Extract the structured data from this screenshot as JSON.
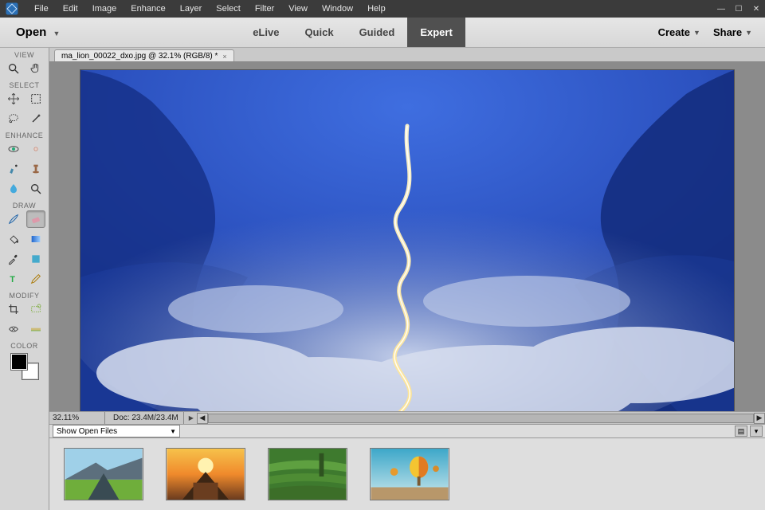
{
  "menubar": {
    "items": [
      "File",
      "Edit",
      "Image",
      "Enhance",
      "Layer",
      "Select",
      "Filter",
      "View",
      "Window",
      "Help"
    ]
  },
  "actionbar": {
    "open_label": "Open",
    "modes": [
      "eLive",
      "Quick",
      "Guided",
      "Expert"
    ],
    "active_mode_index": 3,
    "create_label": "Create",
    "share_label": "Share"
  },
  "tools": {
    "sections": [
      "VIEW",
      "SELECT",
      "ENHANCE",
      "DRAW",
      "MODIFY",
      "COLOR"
    ]
  },
  "document": {
    "tab_label": "ma_lion_00022_dxo.jpg @ 32.1% (RGB/8) *"
  },
  "status": {
    "zoom": "32.11%",
    "docinfo": "Doc: 23.4M/23.4M"
  },
  "openfiles": {
    "dropdown_label": "Show Open Files"
  }
}
